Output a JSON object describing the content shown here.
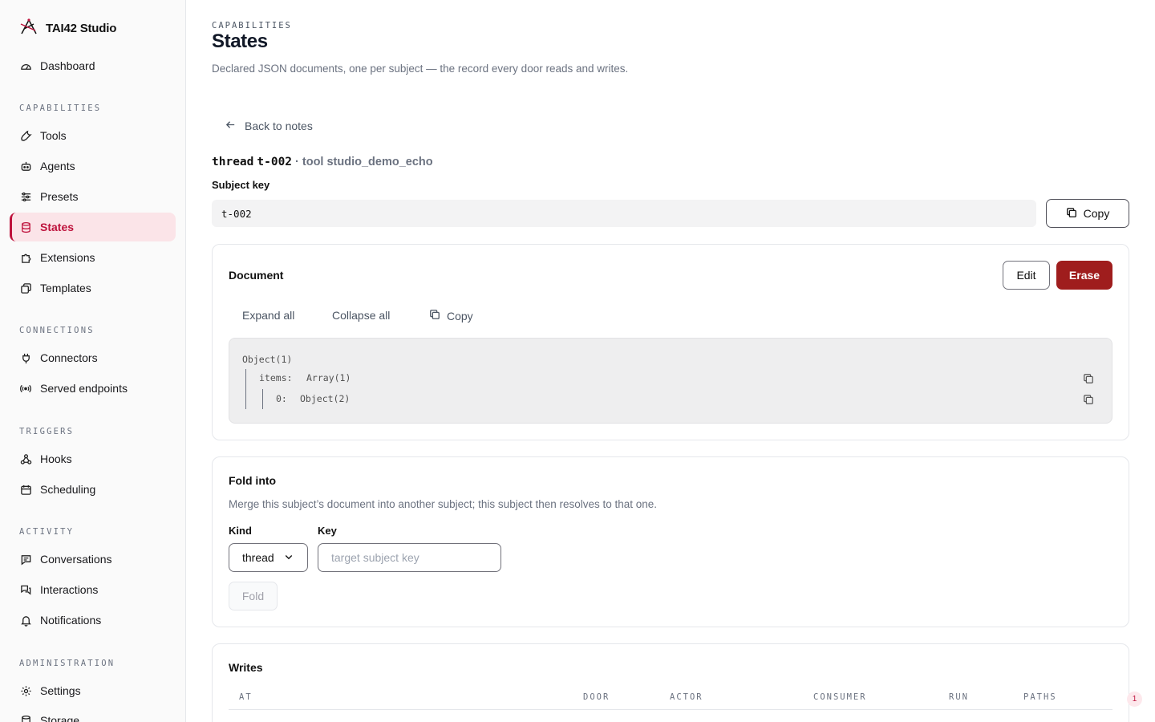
{
  "app": {
    "name": "TAI42 Studio"
  },
  "sidebar": {
    "dashboard": "Dashboard",
    "sections": {
      "capabilities": "CAPABILITIES",
      "connections": "CONNECTIONS",
      "triggers": "TRIGGERS",
      "activity": "ACTIVITY",
      "administration": "ADMINISTRATION"
    },
    "items": {
      "tools": "Tools",
      "agents": "Agents",
      "presets": "Presets",
      "states": "States",
      "extensions": "Extensions",
      "templates": "Templates",
      "connectors": "Connectors",
      "served_endpoints": "Served endpoints",
      "hooks": "Hooks",
      "scheduling": "Scheduling",
      "conversations": "Conversations",
      "interactions": "Interactions",
      "notifications": "Notifications",
      "settings": "Settings",
      "storage": "Storage"
    },
    "active": "states"
  },
  "header": {
    "eyebrow": "CAPABILITIES",
    "title": "States",
    "description": "Declared JSON documents, one per subject — the record every door reads and writes."
  },
  "back_link": "Back to notes",
  "subject": {
    "kind": "thread",
    "key": "t-002",
    "separator": "·",
    "tool_label": "tool studio_demo_echo",
    "key_label": "Subject key",
    "copy_label": "Copy"
  },
  "document": {
    "title": "Document",
    "edit_label": "Edit",
    "erase_label": "Erase",
    "expand_all": "Expand all",
    "collapse_all": "Collapse all",
    "copy_label": "Copy",
    "tree": {
      "root": "Object(1)",
      "items_key": "items:",
      "items_value": "Array(1)",
      "index_key": "0:",
      "index_value": "Object(2)"
    }
  },
  "fold": {
    "title": "Fold into",
    "hint": "Merge this subject’s document into another subject; this subject then resolves to that one.",
    "kind_label": "Kind",
    "kind_value": "thread",
    "key_label": "Key",
    "key_placeholder": "target subject key",
    "button_label": "Fold"
  },
  "writes": {
    "title": "Writes",
    "columns": [
      "AT",
      "DOOR",
      "ACTOR",
      "CONSUMER",
      "RUN",
      "PATHS"
    ]
  },
  "notification_count": "1",
  "colors": {
    "accent": "#be123c",
    "danger": "#9f1d1d",
    "active_bg": "#fbe4e8"
  }
}
